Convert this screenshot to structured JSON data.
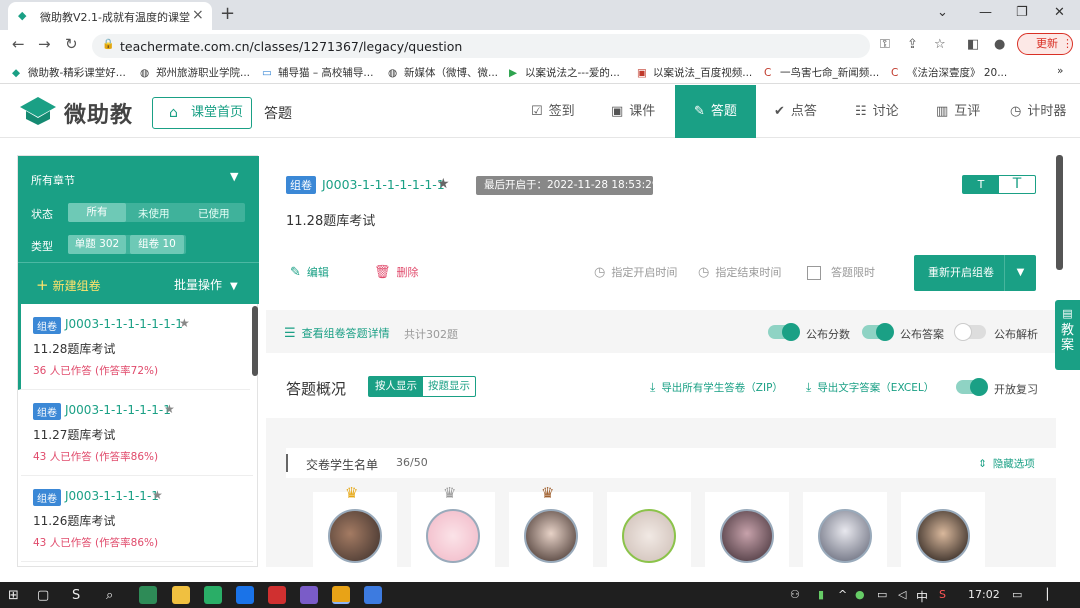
{
  "browser": {
    "tab_title": "微助教V2.1-成就有温度的课堂",
    "url": "teachermate.com.cn/classes/1271367/legacy/question",
    "update_label": "更新",
    "bookmarks": [
      "微助教-精彩课堂好...",
      "郑州旅游职业学院...",
      "辅导猫 – 高校辅导...",
      "新媒体（微博、微...",
      "以案说法之---爱的...",
      "以案说法_百度视频...",
      "一鸟害七命_新闻频...",
      "《法治深壹度》 20..."
    ],
    "bookmarks_more": "»"
  },
  "header": {
    "logo_text": "微助教",
    "home_button": "课堂首页",
    "page_title": "答题",
    "nav": [
      {
        "label": "签到",
        "icon": "calendar-check-icon"
      },
      {
        "label": "课件",
        "icon": "play-screen-icon"
      },
      {
        "label": "答题",
        "icon": "quiz-icon",
        "active": true
      },
      {
        "label": "点答",
        "icon": "check-circle-icon"
      },
      {
        "label": "讨论",
        "icon": "discussion-icon"
      },
      {
        "label": "互评",
        "icon": "chart-icon"
      },
      {
        "label": "计时器",
        "icon": "timer-icon"
      }
    ]
  },
  "sidebar": {
    "chapter_select": "所有章节",
    "status_label": "状态",
    "status_options": [
      "所有",
      "未使用",
      "已使用"
    ],
    "type_label": "类型",
    "type_options": [
      "单题 302",
      "组卷 10"
    ],
    "new_set": "新建组卷",
    "batch_ops": "批量操作",
    "items": [
      {
        "tag": "组卷",
        "code": "J0003-1-1-1-1-1-1-1",
        "name": "11.28题库考试",
        "stat": "36 人已作答 (作答率72%)"
      },
      {
        "tag": "组卷",
        "code": "J0003-1-1-1-1-1-1",
        "name": "11.27题库考试",
        "stat": "43 人已作答 (作答率86%)"
      },
      {
        "tag": "组卷",
        "code": "J0003-1-1-1-1-1",
        "name": "11.26题库考试",
        "stat": "43 人已作答 (作答率86%)"
      }
    ]
  },
  "main": {
    "tag": "组卷",
    "code": "J0003-1-1-1-1-1-1-1",
    "last_open": "最后开启于：2022-11-28 18:53:29",
    "font_small": "T",
    "font_large": "T",
    "title": "11.28题库考试",
    "edit": "编辑",
    "delete": "删除",
    "set_start": "指定开启时间",
    "set_end": "指定结束时间",
    "time_limit": "答题限时",
    "restart": "重新开启组卷",
    "view_details": "查看组卷答题详情",
    "total": "共计302题",
    "publish_score": "公布分数",
    "publish_answer": "公布答案",
    "publish_analysis": "公布解析",
    "overview": "答题概况",
    "view_by_person": "按人显示",
    "view_by_question": "按题显示",
    "export_zip": "导出所有学生答卷（ZIP）",
    "export_excel": "导出文字答案（EXCEL）",
    "open_review": "开放复习",
    "submitted_list": "交卷学生名单",
    "submitted_count": "36/50",
    "hide_items": "隐藏选项",
    "side_tab": "教案"
  },
  "taskbar": {
    "ime": "中",
    "time": "17:02"
  },
  "colors": {
    "accent": "#1aa085",
    "tag_blue": "#3b88d6",
    "stat_red": "#e04a6b"
  }
}
